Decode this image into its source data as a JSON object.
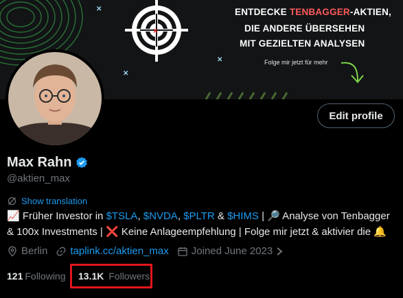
{
  "banner": {
    "line1_pre": "ENTDECKE ",
    "line1_accent": "TENBAGGER",
    "line1_post": "-AKTIEN,",
    "line2": "DIE ANDERE ÜBERSEHEN",
    "line3": "MIT GEZIELTEN ANALYSEN",
    "sub": "Folge mir jetzt für mehr",
    "accent_color": "#ff5a5a"
  },
  "header": {
    "edit_profile_label": "Edit profile"
  },
  "profile": {
    "name": "Max Rahn",
    "handle": "@aktien_max",
    "show_translation": "Show translation",
    "bio": {
      "emoji_chart": "📈",
      "text1": " Früher Investor in ",
      "ticker1": "$TSLA",
      "sep1": ", ",
      "ticker2": "$NVDA",
      "sep2": ", ",
      "ticker3": "$PLTR",
      "sep3": " & ",
      "ticker4": "$HIMS",
      "text2": " | ",
      "emoji_magnifier": "🔎",
      "text3": " Analyse von Tenbagger & 100x Investments | ",
      "emoji_cross": "❌",
      "text4": " Keine Anlageempfehlung | Folge mir jetzt & aktivier die ",
      "emoji_bell": "🔔"
    },
    "location": "Berlin",
    "url": "taplink.cc/aktien_max",
    "joined": "Joined June 2023",
    "following_count": "121",
    "following_label": "Following",
    "followers_count": "13.1K",
    "followers_label": "Followers"
  },
  "colors": {
    "link": "#1d9bf0",
    "muted": "#71767b",
    "highlight_box": "#e3161b"
  }
}
